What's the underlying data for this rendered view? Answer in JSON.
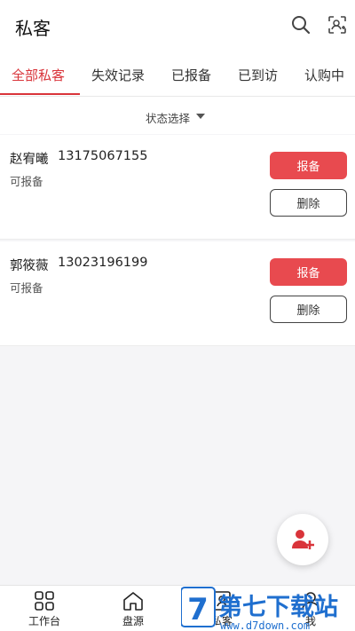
{
  "header": {
    "title": "私客",
    "search_icon": "search-icon",
    "scan_icon": "contact-scan-icon"
  },
  "tabs": [
    {
      "label": "全部私客",
      "active": true
    },
    {
      "label": "失效记录",
      "active": false
    },
    {
      "label": "已报备",
      "active": false
    },
    {
      "label": "已到访",
      "active": false
    },
    {
      "label": "认购中",
      "active": false
    }
  ],
  "filter": {
    "label": "状态选择"
  },
  "customers": [
    {
      "name": "赵宥曦",
      "phone": "13175067155",
      "status": "可报备",
      "report_label": "报备",
      "delete_label": "删除"
    },
    {
      "name": "郭筱薇",
      "phone": "13023196199",
      "status": "可报备",
      "report_label": "报备",
      "delete_label": "删除"
    }
  ],
  "fab": {
    "icon": "add-user-icon"
  },
  "bottom_nav": [
    {
      "label": "工作台",
      "icon": "grid-icon"
    },
    {
      "label": "盘源",
      "icon": "home-icon"
    },
    {
      "label": "私客",
      "icon": "contacts-icon"
    },
    {
      "label": "我",
      "icon": "user-icon"
    }
  ],
  "watermark": {
    "text": "第七下载站",
    "url_text": "www.d7down.com"
  },
  "colors": {
    "accent": "#d9343a",
    "button_red": "#e84a4f",
    "background": "#f5f5f7"
  }
}
